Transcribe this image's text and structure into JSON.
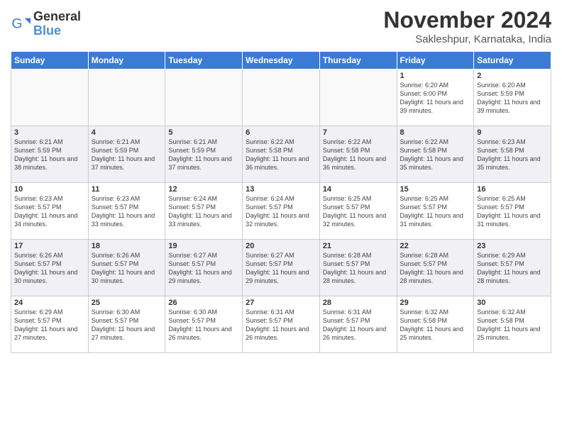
{
  "title": "November 2024",
  "location": "Sakleshpur, Karnataka, India",
  "logo": {
    "general": "General",
    "blue": "Blue"
  },
  "days_of_week": [
    "Sunday",
    "Monday",
    "Tuesday",
    "Wednesday",
    "Thursday",
    "Friday",
    "Saturday"
  ],
  "weeks": [
    [
      {
        "day": "",
        "info": ""
      },
      {
        "day": "",
        "info": ""
      },
      {
        "day": "",
        "info": ""
      },
      {
        "day": "",
        "info": ""
      },
      {
        "day": "",
        "info": ""
      },
      {
        "day": "1",
        "info": "Sunrise: 6:20 AM\nSunset: 6:00 PM\nDaylight: 11 hours and 39 minutes."
      },
      {
        "day": "2",
        "info": "Sunrise: 6:20 AM\nSunset: 5:59 PM\nDaylight: 11 hours and 39 minutes."
      }
    ],
    [
      {
        "day": "3",
        "info": "Sunrise: 6:21 AM\nSunset: 5:59 PM\nDaylight: 11 hours and 38 minutes."
      },
      {
        "day": "4",
        "info": "Sunrise: 6:21 AM\nSunset: 5:59 PM\nDaylight: 11 hours and 37 minutes."
      },
      {
        "day": "5",
        "info": "Sunrise: 6:21 AM\nSunset: 5:59 PM\nDaylight: 11 hours and 37 minutes."
      },
      {
        "day": "6",
        "info": "Sunrise: 6:22 AM\nSunset: 5:58 PM\nDaylight: 11 hours and 36 minutes."
      },
      {
        "day": "7",
        "info": "Sunrise: 6:22 AM\nSunset: 5:58 PM\nDaylight: 11 hours and 36 minutes."
      },
      {
        "day": "8",
        "info": "Sunrise: 6:22 AM\nSunset: 5:58 PM\nDaylight: 11 hours and 35 minutes."
      },
      {
        "day": "9",
        "info": "Sunrise: 6:23 AM\nSunset: 5:58 PM\nDaylight: 11 hours and 35 minutes."
      }
    ],
    [
      {
        "day": "10",
        "info": "Sunrise: 6:23 AM\nSunset: 5:57 PM\nDaylight: 11 hours and 34 minutes."
      },
      {
        "day": "11",
        "info": "Sunrise: 6:23 AM\nSunset: 5:57 PM\nDaylight: 11 hours and 33 minutes."
      },
      {
        "day": "12",
        "info": "Sunrise: 6:24 AM\nSunset: 5:57 PM\nDaylight: 11 hours and 33 minutes."
      },
      {
        "day": "13",
        "info": "Sunrise: 6:24 AM\nSunset: 5:57 PM\nDaylight: 11 hours and 32 minutes."
      },
      {
        "day": "14",
        "info": "Sunrise: 6:25 AM\nSunset: 5:57 PM\nDaylight: 11 hours and 32 minutes."
      },
      {
        "day": "15",
        "info": "Sunrise: 6:25 AM\nSunset: 5:57 PM\nDaylight: 11 hours and 31 minutes."
      },
      {
        "day": "16",
        "info": "Sunrise: 6:25 AM\nSunset: 5:57 PM\nDaylight: 11 hours and 31 minutes."
      }
    ],
    [
      {
        "day": "17",
        "info": "Sunrise: 6:26 AM\nSunset: 5:57 PM\nDaylight: 11 hours and 30 minutes."
      },
      {
        "day": "18",
        "info": "Sunrise: 6:26 AM\nSunset: 5:57 PM\nDaylight: 11 hours and 30 minutes."
      },
      {
        "day": "19",
        "info": "Sunrise: 6:27 AM\nSunset: 5:57 PM\nDaylight: 11 hours and 29 minutes."
      },
      {
        "day": "20",
        "info": "Sunrise: 6:27 AM\nSunset: 5:57 PM\nDaylight: 11 hours and 29 minutes."
      },
      {
        "day": "21",
        "info": "Sunrise: 6:28 AM\nSunset: 5:57 PM\nDaylight: 11 hours and 28 minutes."
      },
      {
        "day": "22",
        "info": "Sunrise: 6:28 AM\nSunset: 5:57 PM\nDaylight: 11 hours and 28 minutes."
      },
      {
        "day": "23",
        "info": "Sunrise: 6:29 AM\nSunset: 5:57 PM\nDaylight: 11 hours and 28 minutes."
      }
    ],
    [
      {
        "day": "24",
        "info": "Sunrise: 6:29 AM\nSunset: 5:57 PM\nDaylight: 11 hours and 27 minutes."
      },
      {
        "day": "25",
        "info": "Sunrise: 6:30 AM\nSunset: 5:57 PM\nDaylight: 11 hours and 27 minutes."
      },
      {
        "day": "26",
        "info": "Sunrise: 6:30 AM\nSunset: 5:57 PM\nDaylight: 11 hours and 26 minutes."
      },
      {
        "day": "27",
        "info": "Sunrise: 6:31 AM\nSunset: 5:57 PM\nDaylight: 11 hours and 26 minutes."
      },
      {
        "day": "28",
        "info": "Sunrise: 6:31 AM\nSunset: 5:57 PM\nDaylight: 11 hours and 26 minutes."
      },
      {
        "day": "29",
        "info": "Sunrise: 6:32 AM\nSunset: 5:58 PM\nDaylight: 11 hours and 25 minutes."
      },
      {
        "day": "30",
        "info": "Sunrise: 6:32 AM\nSunset: 5:58 PM\nDaylight: 11 hours and 25 minutes."
      }
    ]
  ]
}
